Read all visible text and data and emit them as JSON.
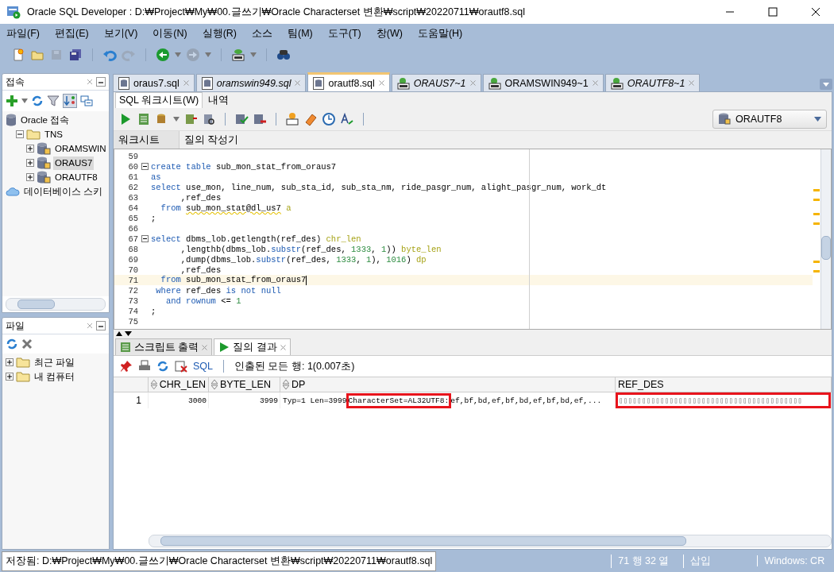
{
  "window": {
    "title": "Oracle SQL Developer : D:₩Project₩My₩00.글쓰기₩Oracle Characterset 변환₩script₩20220711₩orautf8.sql"
  },
  "menu": [
    "파일(F)",
    "편집(E)",
    "보기(V)",
    "이동(N)",
    "실행(R)",
    "소스",
    "팀(M)",
    "도구(T)",
    "창(W)",
    "도움말(H)"
  ],
  "toolbar": [
    {
      "kind": "new",
      "disabled": false
    },
    {
      "kind": "open",
      "disabled": false
    },
    {
      "kind": "save",
      "disabled": true
    },
    {
      "kind": "saveall",
      "disabled": false
    },
    {
      "kind": "sep"
    },
    {
      "kind": "undo",
      "disabled": false
    },
    {
      "kind": "redo",
      "disabled": true
    },
    {
      "kind": "sep"
    },
    {
      "kind": "back",
      "disabled": false
    },
    {
      "kind": "drop"
    },
    {
      "kind": "forward",
      "disabled": true
    },
    {
      "kind": "drop"
    },
    {
      "kind": "sep"
    },
    {
      "kind": "sqldb",
      "disabled": false
    },
    {
      "kind": "drop"
    },
    {
      "kind": "sep"
    },
    {
      "kind": "find",
      "disabled": false
    }
  ],
  "connections_panel": {
    "title": "접속",
    "tree": [
      {
        "label": "Oracle 접속",
        "kind": "db",
        "selected": false,
        "children": [
          {
            "label": "TNS",
            "kind": "folder",
            "selected": false,
            "expanded": true,
            "children": [
              {
                "label": "ORAMSWIN",
                "kind": "conn",
                "selected": false,
                "expanded": false
              },
              {
                "label": "ORAUS7",
                "kind": "conn",
                "selected": true,
                "expanded": false
              },
              {
                "label": "ORAUTF8",
                "kind": "conn",
                "selected": false,
                "expanded": false
              }
            ]
          }
        ]
      },
      {
        "label": "데이터베이스 스키",
        "kind": "cloud",
        "selected": false
      }
    ]
  },
  "files_panel": {
    "title": "파일",
    "tree": [
      {
        "label": "최근 파일",
        "kind": "folder",
        "selected": false,
        "expanded": false
      },
      {
        "label": "내 컴퓨터",
        "kind": "folder",
        "selected": false,
        "expanded": false
      }
    ]
  },
  "doc_tabs": [
    {
      "label": "oraus7.sql",
      "kind": "file",
      "italic": false,
      "selected": false
    },
    {
      "label": "oramswin949.sql",
      "kind": "file",
      "italic": true,
      "selected": false
    },
    {
      "label": "orautf8.sql",
      "kind": "file",
      "italic": false,
      "selected": true
    },
    {
      "label": "ORAUS7~1",
      "kind": "sql",
      "italic": true,
      "selected": false
    },
    {
      "label": "ORAMSWIN949~1",
      "kind": "sql",
      "italic": false,
      "selected": false
    },
    {
      "label": "ORAUTF8~1",
      "kind": "sql",
      "italic": true,
      "selected": false
    }
  ],
  "sub_tabs": [
    {
      "label": "SQL 워크시트(W)",
      "selected": true
    },
    {
      "label": "내역",
      "selected": false
    }
  ],
  "connection_select": {
    "value": "ORAUTF8"
  },
  "worksheet_tabs": [
    {
      "label": "워크시트",
      "selected": true
    },
    {
      "label": "질의 작성기",
      "selected": false
    }
  ],
  "editor": {
    "lines": [
      {
        "no": "59",
        "fold": false,
        "current": false
      },
      {
        "no": "60",
        "fold": true,
        "current": false,
        "tokens": [
          {
            "kind": "kw",
            "text": "create table"
          },
          {
            "kind": "id",
            "text": " sub_mon_stat_from_oraus7"
          }
        ]
      },
      {
        "no": "61",
        "fold": false,
        "current": false,
        "tokens": [
          {
            "kind": "kw",
            "text": "as"
          }
        ]
      },
      {
        "no": "62",
        "fold": false,
        "current": false,
        "tokens": [
          {
            "kind": "kw",
            "text": "select"
          },
          {
            "kind": "id",
            "text": " use_mon, line_num, sub_sta_id, sub_sta_nm, ride_pasgr_num, alight_pasgr_num, work_dt"
          }
        ]
      },
      {
        "no": "63",
        "fold": false,
        "current": false,
        "tokens": [
          {
            "kind": "id",
            "text": "      ,ref_des"
          }
        ]
      },
      {
        "no": "64",
        "fold": false,
        "current": false,
        "tokens": [
          {
            "kind": "kw",
            "text": "  from "
          },
          {
            "kind": "warn",
            "text": "sub_mon_stat@dl_us7"
          },
          {
            "kind": "alias",
            "text": " a"
          }
        ]
      },
      {
        "no": "65",
        "fold": false,
        "current": false,
        "tokens": [
          {
            "kind": "id",
            "text": ";"
          }
        ]
      },
      {
        "no": "66",
        "fold": false,
        "current": false
      },
      {
        "no": "67",
        "fold": true,
        "current": false,
        "tokens": [
          {
            "kind": "kw",
            "text": "select"
          },
          {
            "kind": "id",
            "text": " dbms_lob.getlength(ref_des) "
          },
          {
            "kind": "alias",
            "text": "chr_len"
          }
        ]
      },
      {
        "no": "68",
        "fold": false,
        "current": false,
        "tokens": [
          {
            "kind": "id",
            "text": "      ,lengthb(dbms_lob."
          },
          {
            "kind": "kw",
            "text": "substr"
          },
          {
            "kind": "id",
            "text": "(ref_des, "
          },
          {
            "kind": "num",
            "text": "1333"
          },
          {
            "kind": "id",
            "text": ", "
          },
          {
            "kind": "num",
            "text": "1"
          },
          {
            "kind": "id",
            "text": ")) "
          },
          {
            "kind": "alias",
            "text": "byte_len"
          }
        ]
      },
      {
        "no": "69",
        "fold": false,
        "current": false,
        "tokens": [
          {
            "kind": "id",
            "text": "      ,dump(dbms_lob."
          },
          {
            "kind": "kw",
            "text": "substr"
          },
          {
            "kind": "id",
            "text": "(ref_des, "
          },
          {
            "kind": "num",
            "text": "1333"
          },
          {
            "kind": "id",
            "text": ", "
          },
          {
            "kind": "num",
            "text": "1"
          },
          {
            "kind": "id",
            "text": "), "
          },
          {
            "kind": "num",
            "text": "1016"
          },
          {
            "kind": "id",
            "text": ") "
          },
          {
            "kind": "alias",
            "text": "dp"
          }
        ]
      },
      {
        "no": "70",
        "fold": false,
        "current": false,
        "tokens": [
          {
            "kind": "id",
            "text": "      ,ref_des"
          }
        ]
      },
      {
        "no": "71",
        "fold": false,
        "current": true,
        "tokens": [
          {
            "kind": "kw",
            "text": "  from"
          },
          {
            "kind": "id",
            "text": " sub_mon_stat_from_oraus7"
          }
        ]
      },
      {
        "no": "72",
        "fold": false,
        "current": false,
        "tokens": [
          {
            "kind": "kw",
            "text": " where"
          },
          {
            "kind": "id",
            "text": " ref_des "
          },
          {
            "kind": "kw",
            "text": "is not null"
          }
        ]
      },
      {
        "no": "73",
        "fold": false,
        "current": false,
        "tokens": [
          {
            "kind": "kw",
            "text": "   and rownum"
          },
          {
            "kind": "id",
            "text": " <= "
          },
          {
            "kind": "num",
            "text": "1"
          }
        ]
      },
      {
        "no": "74",
        "fold": false,
        "current": false,
        "tokens": [
          {
            "kind": "id",
            "text": ";"
          }
        ]
      },
      {
        "no": "75",
        "fold": false,
        "current": false
      }
    ]
  },
  "output_tabs": [
    {
      "label": "스크립트 출력",
      "kind": "script",
      "selected": false
    },
    {
      "label": "질의 결과",
      "kind": "run",
      "selected": true
    }
  ],
  "result_toolbar": {
    "sql_link": "SQL",
    "message": "인출된 모든 행: 1(0.007초)"
  },
  "grid": {
    "columns": [
      {
        "label": "CHR_LEN",
        "sortable": true
      },
      {
        "label": "BYTE_LEN",
        "sortable": true
      },
      {
        "label": "DP",
        "sortable": true
      },
      {
        "label": "REF_DES",
        "sortable": false
      }
    ],
    "rows": [
      {
        "no": "1",
        "chr_len": "3000",
        "byte_len": "3999",
        "dp": [
          {
            "text": "Typ=1 Len=3999",
            "highlighted": false
          },
          {
            "text": "CharacterSet=AL32UTF8:",
            "highlighted": true
          },
          {
            "text": "ef,bf,bd,ef,bf,bd,ef,bf,bd,ef,...",
            "highlighted": false
          }
        ],
        "ref_des": {
          "text": "▯▯▯▯▯▯▯▯▯▯▯▯▯▯▯▯▯▯▯▯▯▯▯▯▯▯▯▯▯▯▯▯▯▯▯▯▯▯▯▯",
          "highlighted": true
        }
      }
    ]
  },
  "status_bar": {
    "path": "저장됨: D:₩Project₩My₩00.글쓰기₩Oracle Characterset 변환₩script₩20220711₩orautf8.sql",
    "position": "71 행 32 열",
    "mode": "삽입",
    "line_ending": "Windows: CR"
  }
}
